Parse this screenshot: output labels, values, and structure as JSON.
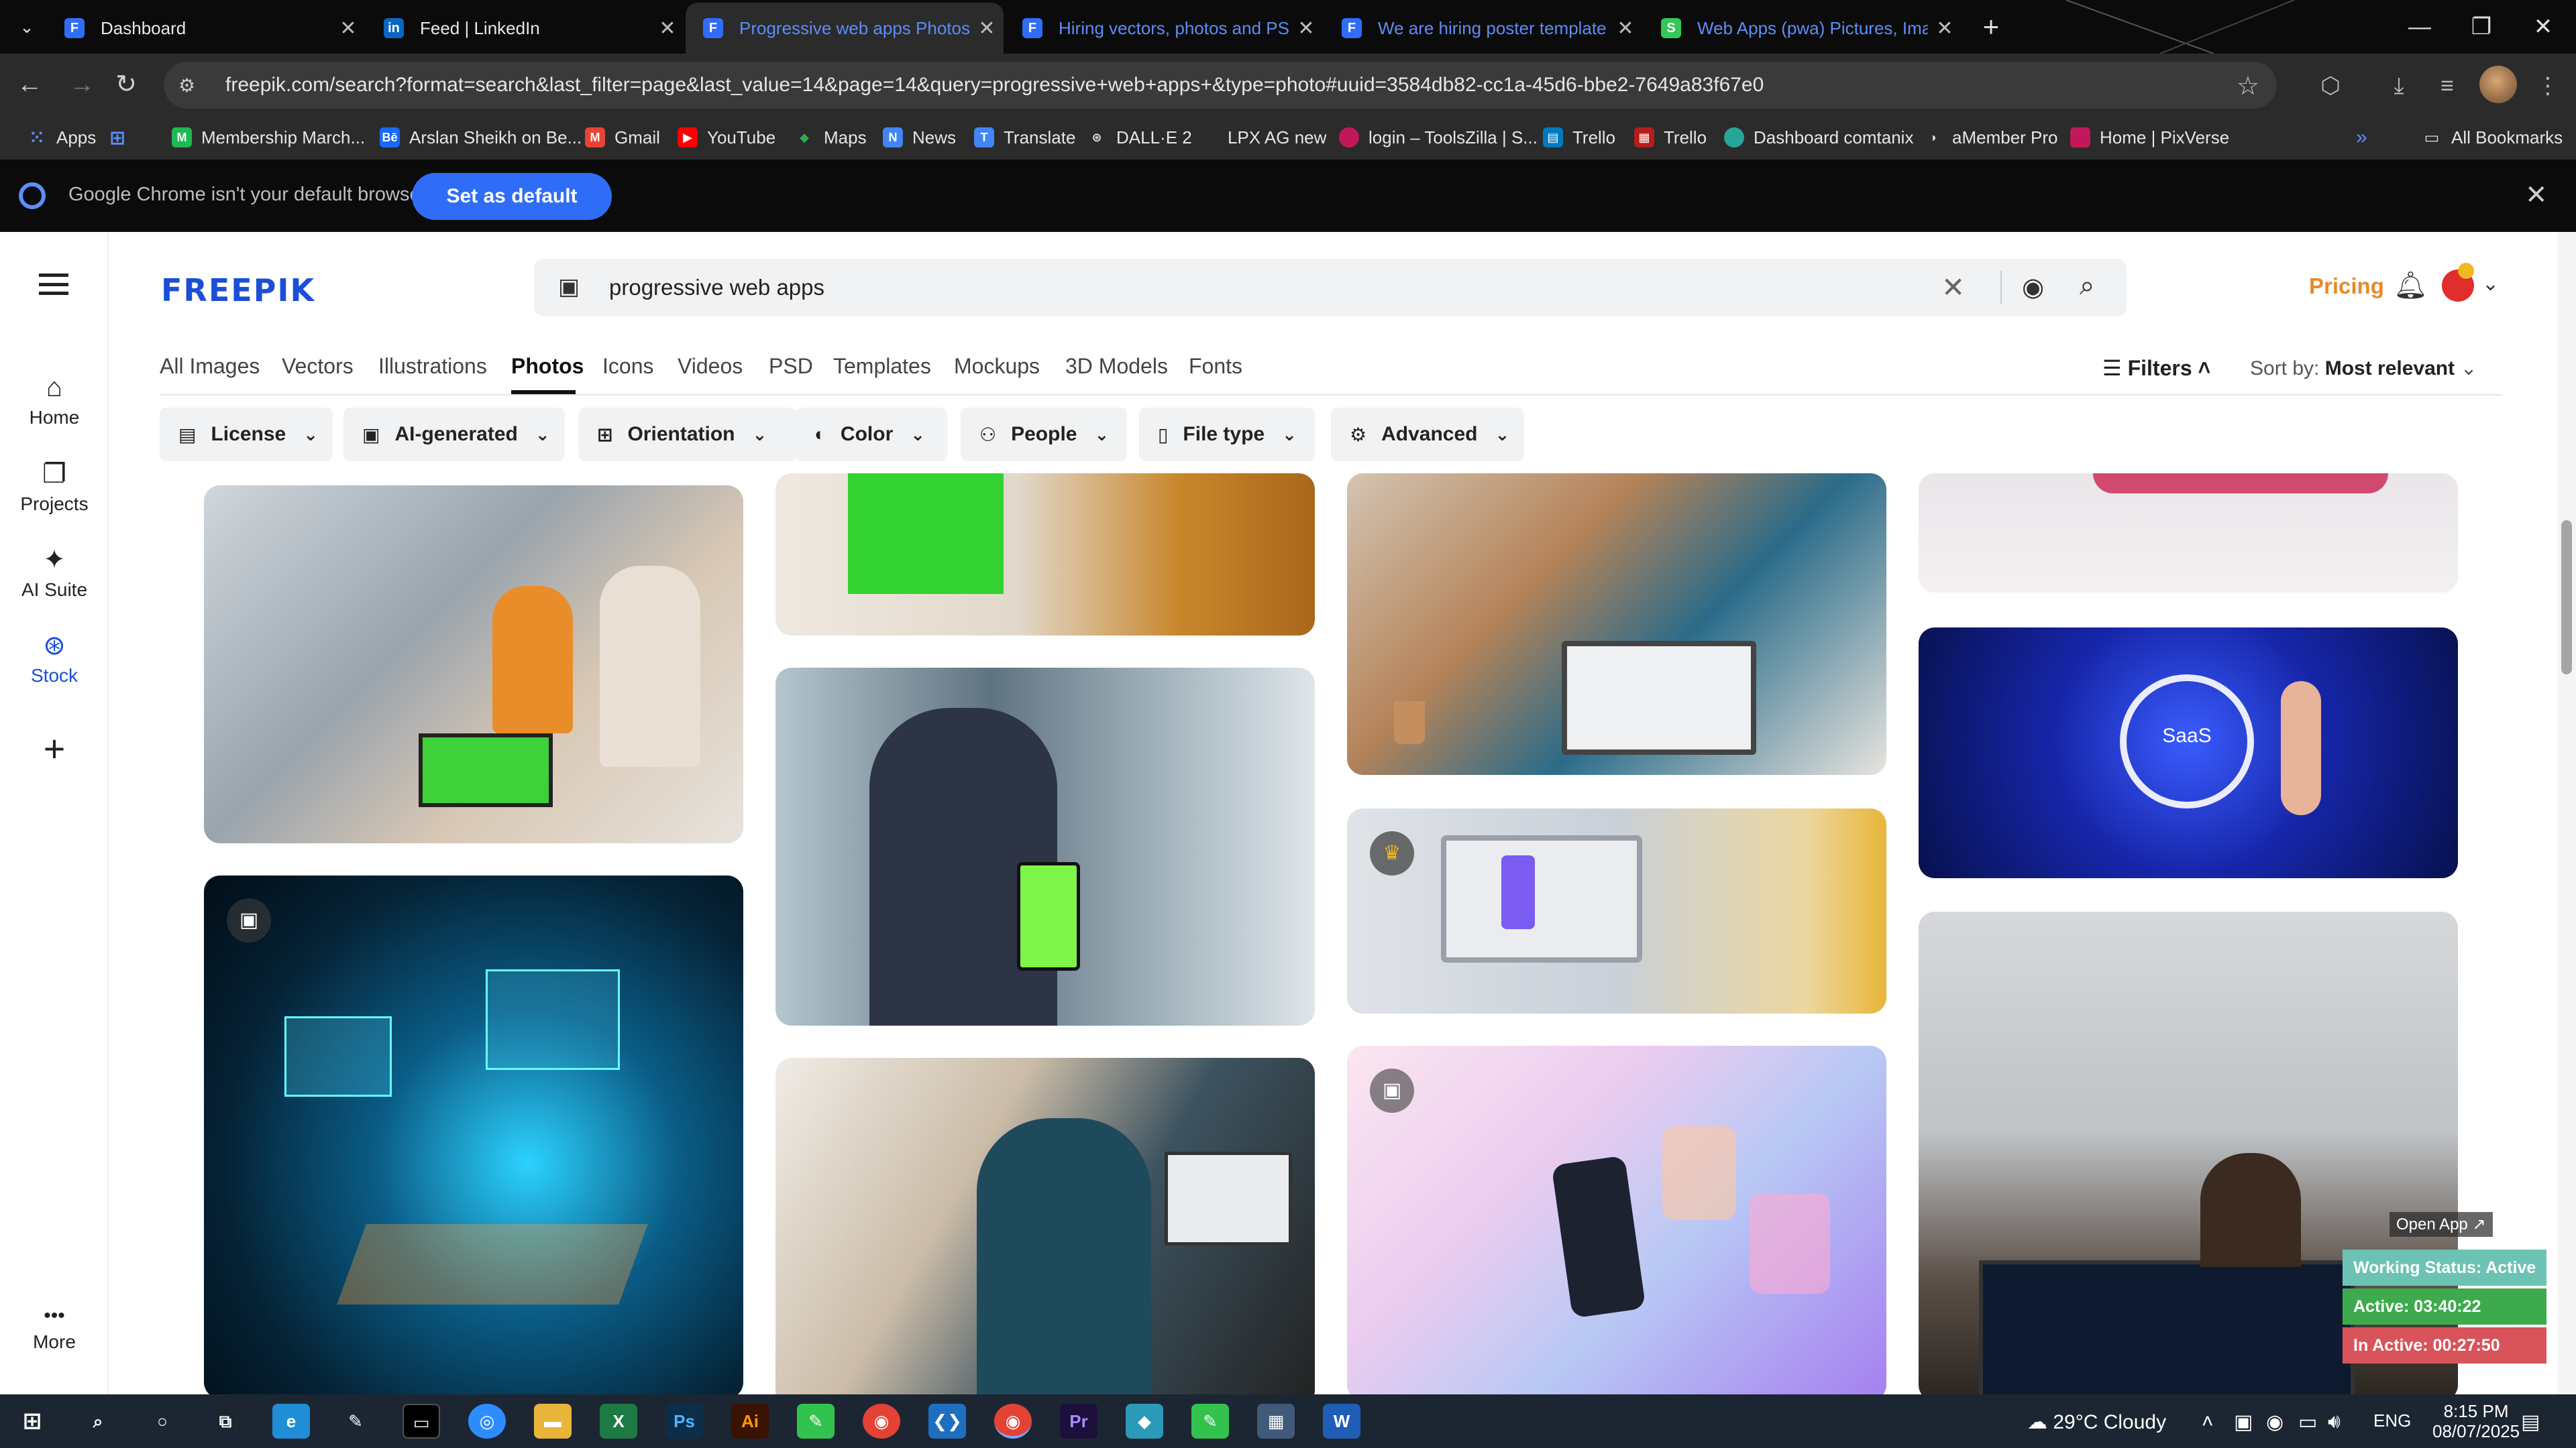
{
  "browser": {
    "tabs": [
      {
        "label": "Dashboard",
        "favicon": "F",
        "color": "#2f6df6",
        "active": false
      },
      {
        "label": "Feed | LinkedIn",
        "favicon": "in",
        "color": "#0a66c2",
        "active": false
      },
      {
        "label": "Progressive web apps Photos | ",
        "favicon": "F",
        "color": "#2f6df6",
        "active": true
      },
      {
        "label": "Hiring vectors, photos and PSD",
        "favicon": "F",
        "color": "#2f6df6",
        "active": false
      },
      {
        "label": "We are hiring poster template |",
        "favicon": "F",
        "color": "#2f6df6",
        "active": false
      },
      {
        "label": "Web Apps (pwa) Pictures, Imag",
        "favicon": "S",
        "color": "#34c759",
        "active": false
      }
    ],
    "url": "freepik.com/search?format=search&last_filter=page&last_value=14&page=14&query=progressive+web+apps+&type=photo#uuid=3584db82-cc1a-45d6-bbe2-7649a83f67e0",
    "bookmarks": [
      {
        "label": "Apps",
        "icon": "grid",
        "color": "#5b8ff9"
      },
      {
        "label": "",
        "icon": "apps-grid",
        "color": "#5b8ff9"
      },
      {
        "label": "Membership March...",
        "icon": "M",
        "color": "#1db954"
      },
      {
        "label": "Arslan Sheikh on Be...",
        "icon": "Bē",
        "color": "#1769ff"
      },
      {
        "label": "Gmail",
        "icon": "M",
        "color": "#ea4335"
      },
      {
        "label": "YouTube",
        "icon": "▶",
        "color": "#ff0000"
      },
      {
        "label": "Maps",
        "icon": "◆",
        "color": "#34a853"
      },
      {
        "label": "News",
        "icon": "N",
        "color": "#4285f4"
      },
      {
        "label": "Translate",
        "icon": "T",
        "color": "#4285f4"
      },
      {
        "label": "DALL·E 2",
        "icon": "⊛",
        "color": "#444"
      },
      {
        "label": "LPX AG new",
        "icon": "",
        "color": "#2b2b2b"
      },
      {
        "label": "login – ToolsZilla | S...",
        "icon": "●",
        "color": "#c2185b"
      },
      {
        "label": "Trello",
        "icon": "▤",
        "color": "#0079bf"
      },
      {
        "label": "Trello",
        "icon": "▦",
        "color": "#b71c1c"
      },
      {
        "label": "Dashboard comtanix",
        "icon": "◉",
        "color": "#26a69a"
      },
      {
        "label": "aMember Pro",
        "icon": "◑",
        "color": "#444"
      },
      {
        "label": "Home | PixVerse",
        "icon": "■",
        "color": "#c2185b"
      },
      {
        "label": "All Bookmarks",
        "icon": "folder",
        "color": "#2b2b2b"
      }
    ],
    "infobar": {
      "message": "Google Chrome isn't your default browser",
      "button": "Set as default"
    }
  },
  "site": {
    "logo": "FREEPIK",
    "leftnav": [
      {
        "label": "Home",
        "icon": "⌂"
      },
      {
        "label": "Projects",
        "icon": "❐"
      },
      {
        "label": "AI Suite",
        "icon": "✦"
      },
      {
        "label": "Stock",
        "icon": "⊛"
      },
      {
        "label": "",
        "icon": "+"
      },
      {
        "label": "More",
        "icon": "•••"
      }
    ],
    "search": {
      "value": "progressive web apps",
      "placeholder": "Search"
    },
    "pricing": "Pricing",
    "categories": [
      "All Images",
      "Vectors",
      "Illustrations",
      "Photos",
      "Icons",
      "Videos",
      "PSD",
      "Templates",
      "Mockups",
      "3D Models",
      "Fonts"
    ],
    "active_category": "Photos",
    "filters_label": "Filters",
    "sort_label": "Sort by:",
    "sort_value": "Most relevant",
    "filter_chips": [
      {
        "label": "License",
        "icon": "▤"
      },
      {
        "label": "AI-generated",
        "icon": "▣"
      },
      {
        "label": "Orientation",
        "icon": "⊞"
      },
      {
        "label": "Color",
        "icon": "◐"
      },
      {
        "label": "People",
        "icon": "⚇"
      },
      {
        "label": "File type",
        "icon": "▯"
      },
      {
        "label": "Advanced",
        "icon": "⚙"
      }
    ],
    "images": [
      {
        "name": "women-team-laptop-green-screen",
        "badge": ""
      },
      {
        "name": "holographic-dashboard-hand",
        "badge": "ai"
      },
      {
        "name": "desk-green-screen-monitor",
        "badge": ""
      },
      {
        "name": "businessman-tablet-green-screen",
        "badge": ""
      },
      {
        "name": "bearded-man-phone-office",
        "badge": ""
      },
      {
        "name": "team-laptop-charts-table",
        "badge": ""
      },
      {
        "name": "laptop-app-ui-design",
        "badge": "crown"
      },
      {
        "name": "hand-phone-floating-app-cards",
        "badge": "ai"
      },
      {
        "name": "pink-device-top",
        "badge": ""
      },
      {
        "name": "saas-hologram-hand",
        "badge": ""
      },
      {
        "name": "office-woman-dashboard-screen",
        "badge": ""
      }
    ]
  },
  "tracker": {
    "open": "Open App ↗",
    "status": "Working Status: Active",
    "active": "Active: 03:40:22",
    "inactive": "In Active: 00:27:50"
  },
  "taskbar": {
    "weather": "29°C  Cloudy",
    "lang": "ENG",
    "time": "8:15 PM",
    "date": "08/07/2025",
    "apps": [
      "start-icon",
      "search-icon",
      "cortana-icon",
      "taskview-icon",
      "edge-icon",
      "pen-icon",
      "terminal-icon",
      "zoom-icon",
      "file-explorer-icon",
      "excel-icon",
      "photoshop-icon",
      "illustrator-icon",
      "app-green-icon",
      "chrome-icon",
      "vscode-icon",
      "chrome-profile-icon",
      "premiere-icon",
      "app-diamond-icon",
      "app-green2-icon",
      "calculator-icon",
      "word-icon"
    ]
  }
}
